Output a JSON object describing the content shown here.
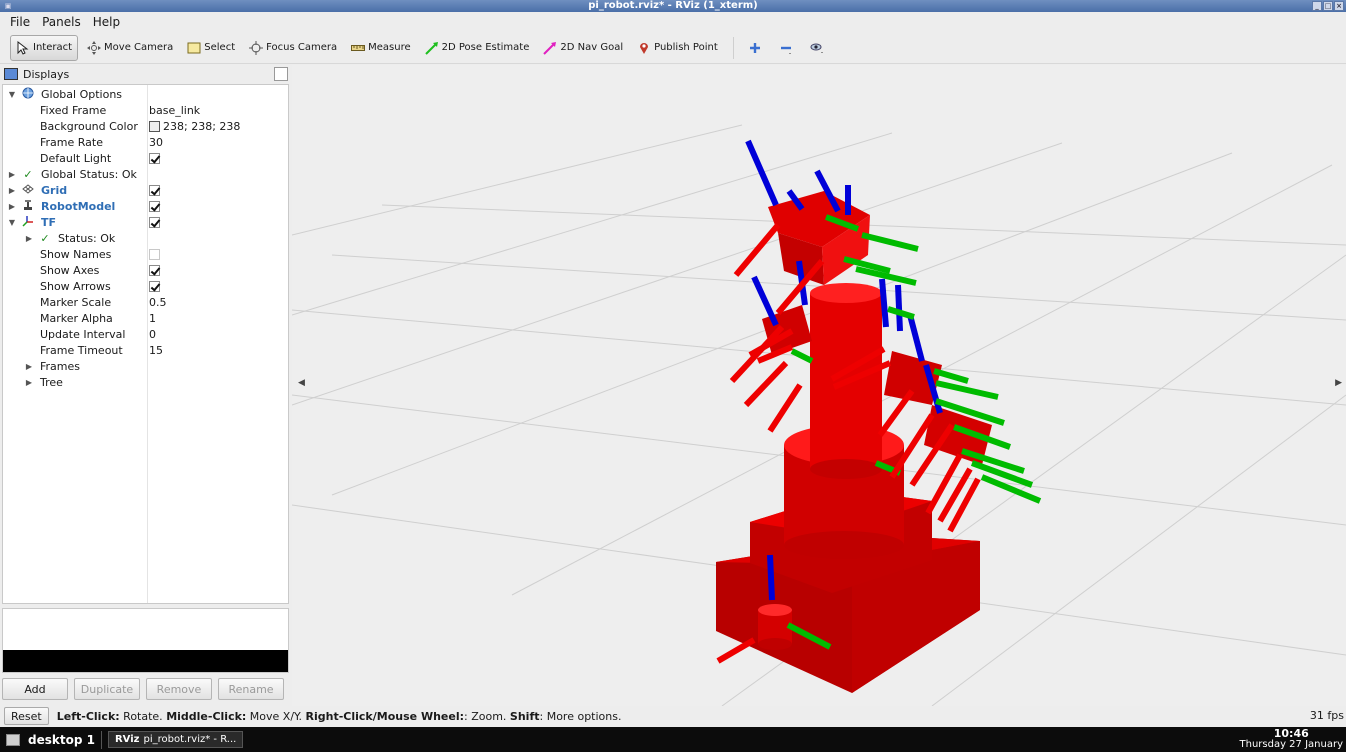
{
  "window": {
    "title": "pi_robot.rviz* - RViz (1_xterm)"
  },
  "menu": [
    "File",
    "Panels",
    "Help"
  ],
  "toolbar": {
    "tools": [
      {
        "label": "Interact",
        "icon": "cursor-icon",
        "active": true
      },
      {
        "label": "Move Camera",
        "icon": "move-camera-icon"
      },
      {
        "label": "Select",
        "icon": "select-icon"
      },
      {
        "label": "Focus Camera",
        "icon": "focus-camera-icon"
      },
      {
        "label": "Measure",
        "icon": "ruler-icon"
      },
      {
        "label": "2D Pose Estimate",
        "icon": "green-arrow-icon"
      },
      {
        "label": "2D Nav Goal",
        "icon": "magenta-arrow-icon"
      },
      {
        "label": "Publish Point",
        "icon": "map-pin-icon"
      }
    ]
  },
  "displays": {
    "title": "Displays",
    "rows": {
      "global_options": "Global Options",
      "fixed_frame": {
        "label": "Fixed Frame",
        "value": "base_link"
      },
      "background_color": {
        "label": "Background Color",
        "value": "238; 238; 238"
      },
      "frame_rate": {
        "label": "Frame Rate",
        "value": "30"
      },
      "default_light": {
        "label": "Default Light",
        "checked": true
      },
      "global_status": "Global Status: Ok",
      "grid": {
        "label": "Grid",
        "checked": true
      },
      "robot_model": {
        "label": "RobotModel",
        "checked": true
      },
      "tf": {
        "label": "TF",
        "checked": true
      },
      "tf_status": "Status: Ok",
      "show_names": {
        "label": "Show Names",
        "checked": false
      },
      "show_axes": {
        "label": "Show Axes",
        "checked": true
      },
      "show_arrows": {
        "label": "Show Arrows",
        "checked": true
      },
      "marker_scale": {
        "label": "Marker Scale",
        "value": "0.5"
      },
      "marker_alpha": {
        "label": "Marker Alpha",
        "value": "1"
      },
      "update_interval": {
        "label": "Update Interval",
        "value": "0"
      },
      "frame_timeout": {
        "label": "Frame Timeout",
        "value": "15"
      },
      "frames": "Frames",
      "tree": "Tree"
    },
    "buttons": {
      "add": "Add",
      "duplicate": "Duplicate",
      "remove": "Remove",
      "rename": "Rename"
    }
  },
  "status": {
    "reset": "Reset",
    "hint": [
      {
        "b": "Left-Click:",
        "t": " Rotate. "
      },
      {
        "b": "Middle-Click:",
        "t": " Move X/Y. "
      },
      {
        "b": "Right-Click/Mouse Wheel:",
        "t": ": Zoom. "
      },
      {
        "b": "Shift",
        "t": ": More options."
      }
    ],
    "fps": "31 fps"
  },
  "taskbar": {
    "desktop": "desktop 1",
    "task_app": "RViz",
    "task_label": "pi_robot.rviz* - R...",
    "time": "10:46",
    "date": "Thursday 27 January"
  },
  "colors": {
    "robot": "#e00000",
    "axis_x": "#e00000",
    "axis_y": "#00cc00",
    "axis_z": "#0000cc",
    "viewport_bg": "#eeeeee",
    "grid": "#d0d0d0"
  }
}
